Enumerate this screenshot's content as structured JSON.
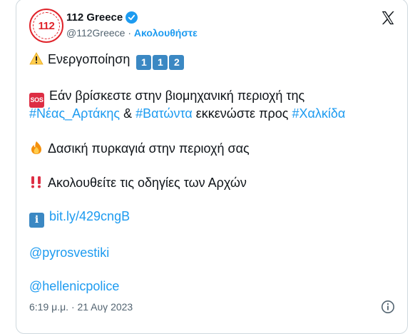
{
  "tweet": {
    "author_name": "112 Greece",
    "avatar_text": "112",
    "handle": "@112Greece",
    "separator": "·",
    "follow_label": "Ακολουθήστε",
    "timestamp": "6:19 μ.μ. · 21 Αυγ 2023",
    "lines": {
      "activation_text": "Ενεργοποίηση",
      "activation_digits": [
        "1",
        "1",
        "2"
      ],
      "sos_label": "SOS",
      "line2_text": "Εάν βρίσκεστε στην βιομηχανική περιοχή της",
      "hashtag_nea_artaki": "#Νέας_Αρτάκης",
      "amp": "&",
      "hashtag_vatonta": "#Βατώντα",
      "evacuate_text": "εκκενώστε προς",
      "hashtag_chalkida": "#Χαλκίδα",
      "fire_text": "Δασική πυρκαγιά στην περιοχή σας",
      "follow_text": "Ακολουθείτε τις οδηγίες των Αρχών",
      "info_symbol": "i",
      "link": "bit.ly/429cngB",
      "mention_pyrosvestiki": "@pyrosvestiki",
      "mention_hellenicpolice": "@hellenicpolice"
    }
  },
  "colors": {
    "link": "#1d9bf0",
    "text": "#0f1419",
    "muted": "#536471",
    "brand_red": "#e0242b"
  },
  "icons": [
    "verified-badge-icon",
    "x-logo-icon",
    "warning-icon",
    "sos-icon",
    "fire-icon",
    "double-exclamation-icon",
    "info-icon"
  ]
}
